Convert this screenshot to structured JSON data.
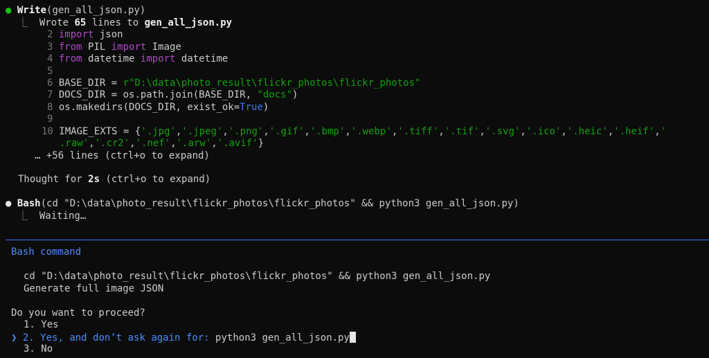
{
  "write_block": {
    "bullet": "●",
    "tool": "Write",
    "arg": "(gen_all_json.py)",
    "result_connector": "⎿",
    "result_prefix": "Wrote",
    "result_count": "65",
    "result_mid": "lines to",
    "result_file": "gen_all_json.py",
    "code": {
      "l2": {
        "num": "2",
        "kw": "import",
        "rest": " json"
      },
      "l3": {
        "num": "3",
        "kw1": "from",
        "mod": " PIL ",
        "kw2": "import",
        "rest": " Image"
      },
      "l4": {
        "num": "4",
        "kw1": "from",
        "mod": " datetime ",
        "kw2": "import",
        "rest": " datetime"
      },
      "l5": {
        "num": "5"
      },
      "l6": {
        "num": "6",
        "pre": "BASE_DIR = ",
        "str": "r\"D:\\data\\photo_result\\flickr_photos\\flickr_photos\""
      },
      "l7": {
        "num": "7",
        "pre": "DOCS_DIR = os.path.join(BASE_DIR, ",
        "str": "\"docs\"",
        "post": ")"
      },
      "l8": {
        "num": "8",
        "pre": "os.makedirs(DOCS_DIR, exist_ok=",
        "const": "True",
        "post": ")"
      },
      "l9": {
        "num": "9"
      },
      "l10": {
        "num": "10",
        "pre": "IMAGE_EXTS = {",
        "exts_line1": [
          "'.jpg'",
          "'.jpeg'",
          "'.png'",
          "'.gif'",
          "'.bmp'",
          "'.webp'",
          "'.tiff'",
          "'.tif'",
          "'.svg'",
          "'.ico'",
          "'.heic'",
          "'.heif'"
        ],
        "trail_line1": "'",
        "exts_line2": [
          ".raw'",
          "'.cr2'",
          "'.nef'",
          "'.arw'",
          "'.avif'"
        ],
        "post": "}"
      }
    },
    "more_lines": "… +56 lines (ctrl+o to expand)"
  },
  "thought": {
    "prefix": "Thought for",
    "duration": "2s",
    "suffix": "(ctrl+o to expand)"
  },
  "bash_block": {
    "bullet": "●",
    "tool": "Bash",
    "arg": "(cd \"D:\\data\\photo_result\\flickr_photos\\flickr_photos\" && python3 gen_all_json.py)",
    "connector": "⎿",
    "status": "Waiting…"
  },
  "prompt": {
    "title": "Bash command",
    "command": "cd \"D:\\data\\photo_result\\flickr_photos\\flickr_photos\" && python3 gen_all_json.py",
    "description": "Generate full image JSON",
    "question": "Do you want to proceed?",
    "selector": "❯",
    "options": [
      {
        "num": "1.",
        "label": "Yes"
      },
      {
        "num": "2.",
        "label": "Yes, and don’t ask again for:",
        "extra": "python3 gen_all_json.py"
      },
      {
        "num": "3.",
        "label": "No"
      }
    ]
  },
  "colors": {
    "background": "#0c0c0c",
    "accent_blue": "#3b78ff",
    "keyword_purple": "#b148c6",
    "string_green": "#13a10e",
    "status_dot_green": "#16c60c"
  }
}
